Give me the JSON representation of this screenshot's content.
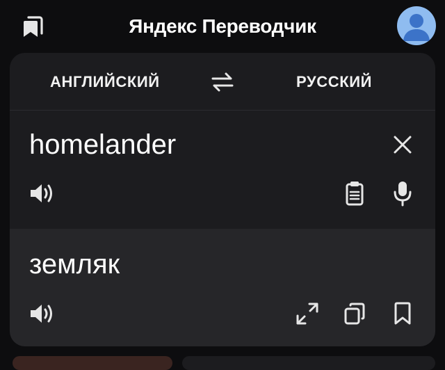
{
  "header": {
    "title": "Яндекс Переводчик",
    "bookmarks_icon": "bookmarks-icon",
    "avatar_icon": "user-avatar-icon",
    "avatar_color": "#8fbcf0"
  },
  "languages": {
    "source": "АНГЛИЙСКИЙ",
    "target": "РУССКИЙ",
    "swap_icon": "swap-arrows-icon"
  },
  "source": {
    "text": "homelander",
    "actions": [
      "speaker-icon",
      "paste-clipboard-icon",
      "microphone-icon",
      "close-icon"
    ]
  },
  "result": {
    "text": "земляк",
    "actions": [
      "speaker-icon",
      "expand-icon",
      "copy-icon",
      "bookmark-icon"
    ]
  },
  "colors": {
    "background": "#0d0d0f",
    "card": "#1c1c1f",
    "result_bg": "#262629",
    "text": "#ffffff",
    "icon": "#e6e6e6"
  }
}
